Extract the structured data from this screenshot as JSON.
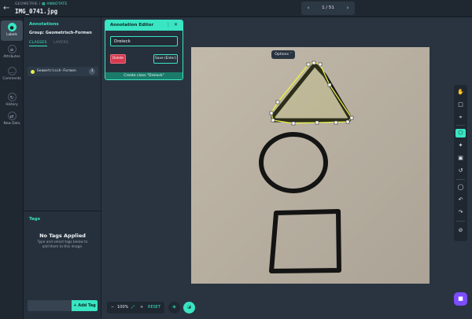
{
  "header": {
    "breadcrumb_project": "GEOMETRIE",
    "breadcrumb_sep": "/",
    "breadcrumb_mode": "ANNOTATE",
    "filename": "IMG_0741.jpg",
    "page_indicator": "1 / 51"
  },
  "rail": {
    "items": [
      {
        "label": "Labels"
      },
      {
        "label": "Attributes"
      },
      {
        "label": "Comments"
      },
      {
        "label": "History"
      },
      {
        "label": "New Data"
      }
    ]
  },
  "panel": {
    "title": "Annotations",
    "group": "Group: Geometrisch-Formen",
    "tab_classes": "CLASSES",
    "tab_layers": "LAYERS",
    "classes": [
      {
        "name": "Geometrisch-Formen",
        "count": "3",
        "color": "#e6f04a"
      }
    ]
  },
  "tags": {
    "title": "Tags",
    "empty_title": "No Tags Applied",
    "empty_sub": "Type and select tags below to add them to this image.",
    "add_button": "+ Add Tag"
  },
  "editor": {
    "title": "Annotation Editor",
    "input_value": "Dreieck",
    "delete_label": "Delete",
    "save_label": "Save (Enter)",
    "create_label": "Create class \"Dreieck\""
  },
  "canvas": {
    "options_label": "Options"
  },
  "zoom": {
    "minus": "−",
    "level": "100%",
    "plus": "+",
    "reset": "RESET"
  },
  "colors": {
    "accent": "#39e5c3",
    "danger": "#d53a4f",
    "help": "#7c4dff"
  }
}
